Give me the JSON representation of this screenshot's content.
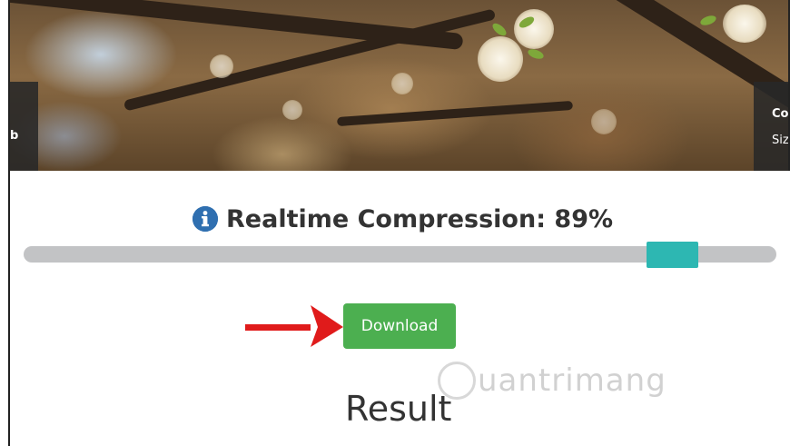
{
  "banner": {
    "left_panel_text": "b",
    "right_panel_title": "Co",
    "right_panel_sub": "Siz"
  },
  "compression": {
    "label": "Realtime Compression: 89%",
    "icon": "info-circle-icon",
    "value_percent": 89,
    "slider_position": 0.86
  },
  "actions": {
    "download_label": "Download"
  },
  "result": {
    "heading": "Result"
  },
  "watermark": {
    "text": "uantrimang"
  },
  "colors": {
    "slider_track": "#c2c3c5",
    "slider_handle": "#2db7b2",
    "download_bg": "#4caf50",
    "info_icon": "#2f6fb0",
    "arrow": "#e01b1b"
  }
}
